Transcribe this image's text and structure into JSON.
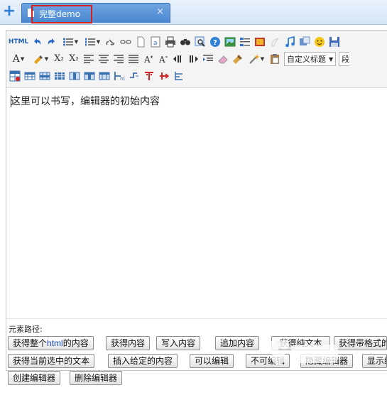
{
  "tabbar": {
    "add_label": "+",
    "active_tab": {
      "label": "完整demo",
      "close_label": "×"
    }
  },
  "toolbar": {
    "row1": [
      "html-source-icon",
      "undo-icon",
      "redo-icon",
      "unordered-list-icon",
      "ordered-list-icon",
      "link-icon",
      "unlink-icon",
      "anchor-icon",
      "text-box-icon",
      "print-icon",
      "search-icon",
      "preview-icon",
      "help-icon",
      "image-icon",
      "insert-frame-icon",
      "background-image-icon",
      "insert-code-icon",
      "music-icon",
      "insert-map-icon",
      "emotion-icon",
      "save-icon"
    ],
    "row1_text": {
      "html": "HTML"
    },
    "row2": [
      "font-color-icon",
      "highlight-icon",
      "superscript-icon",
      "subscript-icon",
      "align-left-icon",
      "align-center-icon",
      "align-right-icon",
      "justify-icon",
      "font-size-up-icon",
      "font-size-down-icon",
      "ltr-icon",
      "rtl-icon",
      "indent-icon",
      "eraser-icon",
      "format-brush-icon",
      "magic-wand-icon",
      "paste-text-icon",
      "dropdown-title-icon"
    ],
    "row2_text": {
      "font_color": "A",
      "superscript": "X",
      "subscript": "X",
      "sup_mark": "2",
      "sub_mark": "2"
    },
    "heading_select": {
      "value": "自定义标题",
      "next_value": "段"
    },
    "row3": [
      "insert-table-icon",
      "delete-table-icon",
      "insert-row-icon",
      "delete-row-icon",
      "insert-col-icon",
      "delete-col-icon",
      "merge-cells-icon",
      "merge-right-icon",
      "merge-down-icon",
      "split-cells-icon",
      "split-rows-icon",
      "split-cols-icon"
    ]
  },
  "content": {
    "text": "这里可以书写，编辑器的初始内容"
  },
  "path": {
    "label": "元素路径:"
  },
  "buttons": {
    "row1": [
      {
        "pre": "获得整个",
        "em": "html",
        "post": "的内容"
      },
      {
        "label": "获得内容"
      },
      {
        "label": "写入内容"
      },
      {
        "label": "追加内容"
      },
      {
        "label": "获得纯文本"
      },
      {
        "label": "获得带格式的纯文本"
      }
    ],
    "row2": [
      {
        "label": "获得当前选中的文本"
      },
      {
        "label": "插入给定的内容"
      },
      {
        "label": "可以编辑"
      },
      {
        "label": "不可编辑"
      },
      {
        "label": "隐藏编辑器"
      },
      {
        "label": "显示编辑器"
      }
    ],
    "row3": [
      {
        "label": "创建编辑器"
      },
      {
        "label": "删除编辑器"
      }
    ]
  },
  "colors": {
    "tab_active": "#4a86cf",
    "highlight": "#d32020",
    "link_blue": "#1a4fb0"
  }
}
